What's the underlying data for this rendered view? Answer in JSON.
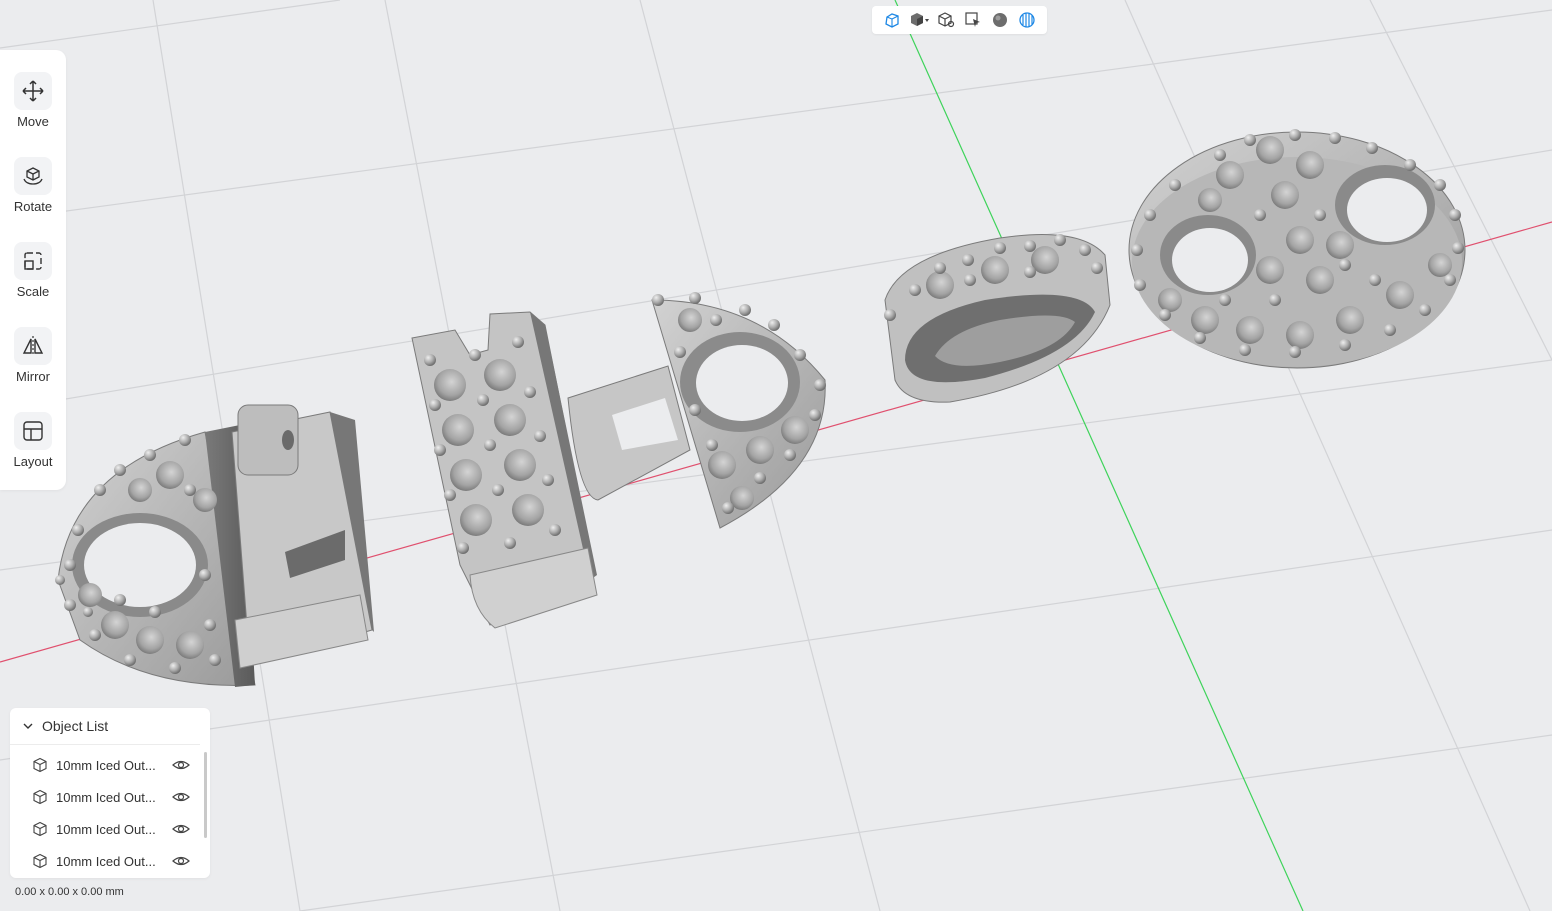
{
  "view_toolbar": {
    "icons": [
      "perspective-cube-icon",
      "shaded-cube-dropdown-icon",
      "wireframe-cube-icon",
      "select-cursor-icon",
      "sphere-icon",
      "striped-sphere-icon"
    ]
  },
  "tools": [
    {
      "label": "Move",
      "icon": "move-icon"
    },
    {
      "label": "Rotate",
      "icon": "rotate-icon"
    },
    {
      "label": "Scale",
      "icon": "scale-icon"
    },
    {
      "label": "Mirror",
      "icon": "mirror-icon"
    },
    {
      "label": "Layout",
      "icon": "layout-icon"
    }
  ],
  "object_list": {
    "title": "Object List",
    "items": [
      {
        "name": "10mm Iced Out..."
      },
      {
        "name": "10mm Iced Out..."
      },
      {
        "name": "10mm Iced Out..."
      },
      {
        "name": "10mm Iced Out..."
      }
    ]
  },
  "dimensions": "0.00 x 0.00 x 0.00 mm",
  "colors": {
    "background": "#ebecee",
    "grid": "#d2d3d6",
    "x_axis": "#e0506e",
    "y_axis": "#3ed35a",
    "model": "#b9b9b9",
    "accent": "#1e88e5"
  }
}
